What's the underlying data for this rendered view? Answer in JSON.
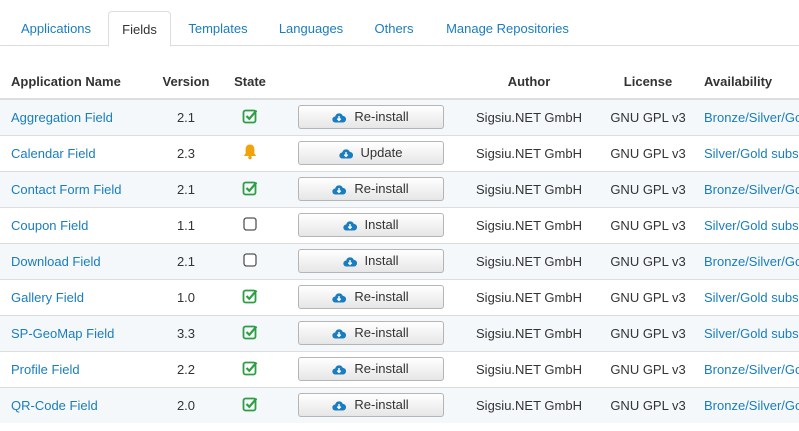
{
  "tabs": [
    {
      "label": "Applications",
      "active": false
    },
    {
      "label": "Fields",
      "active": true
    },
    {
      "label": "Templates",
      "active": false
    },
    {
      "label": "Languages",
      "active": false
    },
    {
      "label": "Others",
      "active": false
    },
    {
      "label": "Manage Repositories",
      "active": false
    }
  ],
  "table": {
    "headers": {
      "name": "Application Name",
      "version": "Version",
      "state": "State",
      "action": "",
      "author": "Author",
      "license": "License",
      "availability": "Availability"
    },
    "rows": [
      {
        "name": "Aggregation Field",
        "version": "2.1",
        "state": "installed",
        "action": "Re-install",
        "author": "Sigsiu.NET GmbH",
        "license": "GNU GPL v3",
        "availability": "Bronze/Silver/Go"
      },
      {
        "name": "Calendar Field",
        "version": "2.3",
        "state": "update",
        "action": "Update",
        "author": "Sigsiu.NET GmbH",
        "license": "GNU GPL v3",
        "availability": "Silver/Gold subs"
      },
      {
        "name": "Contact Form Field",
        "version": "2.1",
        "state": "installed",
        "action": "Re-install",
        "author": "Sigsiu.NET GmbH",
        "license": "GNU GPL v3",
        "availability": "Bronze/Silver/Go"
      },
      {
        "name": "Coupon Field",
        "version": "1.1",
        "state": "not-installed",
        "action": "Install",
        "author": "Sigsiu.NET GmbH",
        "license": "GNU GPL v3",
        "availability": "Silver/Gold subs"
      },
      {
        "name": "Download Field",
        "version": "2.1",
        "state": "not-installed",
        "action": "Install",
        "author": "Sigsiu.NET GmbH",
        "license": "GNU GPL v3",
        "availability": "Bronze/Silver/Go"
      },
      {
        "name": "Gallery Field",
        "version": "1.0",
        "state": "installed",
        "action": "Re-install",
        "author": "Sigsiu.NET GmbH",
        "license": "GNU GPL v3",
        "availability": "Silver/Gold subs"
      },
      {
        "name": "SP-GeoMap Field",
        "version": "3.3",
        "state": "installed",
        "action": "Re-install",
        "author": "Sigsiu.NET GmbH",
        "license": "GNU GPL v3",
        "availability": "Silver/Gold subs"
      },
      {
        "name": "Profile Field",
        "version": "2.2",
        "state": "installed",
        "action": "Re-install",
        "author": "Sigsiu.NET GmbH",
        "license": "GNU GPL v3",
        "availability": "Bronze/Silver/Go"
      },
      {
        "name": "QR-Code Field",
        "version": "2.0",
        "state": "installed",
        "action": "Re-install",
        "author": "Sigsiu.NET GmbH",
        "license": "GNU GPL v3",
        "availability": "Bronze/Silver/Go"
      }
    ]
  },
  "icons": {
    "installed": "check-square-icon",
    "update": "bell-icon",
    "not-installed": "empty-checkbox-icon",
    "action": "cloud-download-icon"
  },
  "colors": {
    "link": "#1a7dbf",
    "check": "#2e9e44",
    "bell": "#f0a30a",
    "cloud": "#1a7dbf",
    "row_stripe": "#f4f8fb"
  }
}
